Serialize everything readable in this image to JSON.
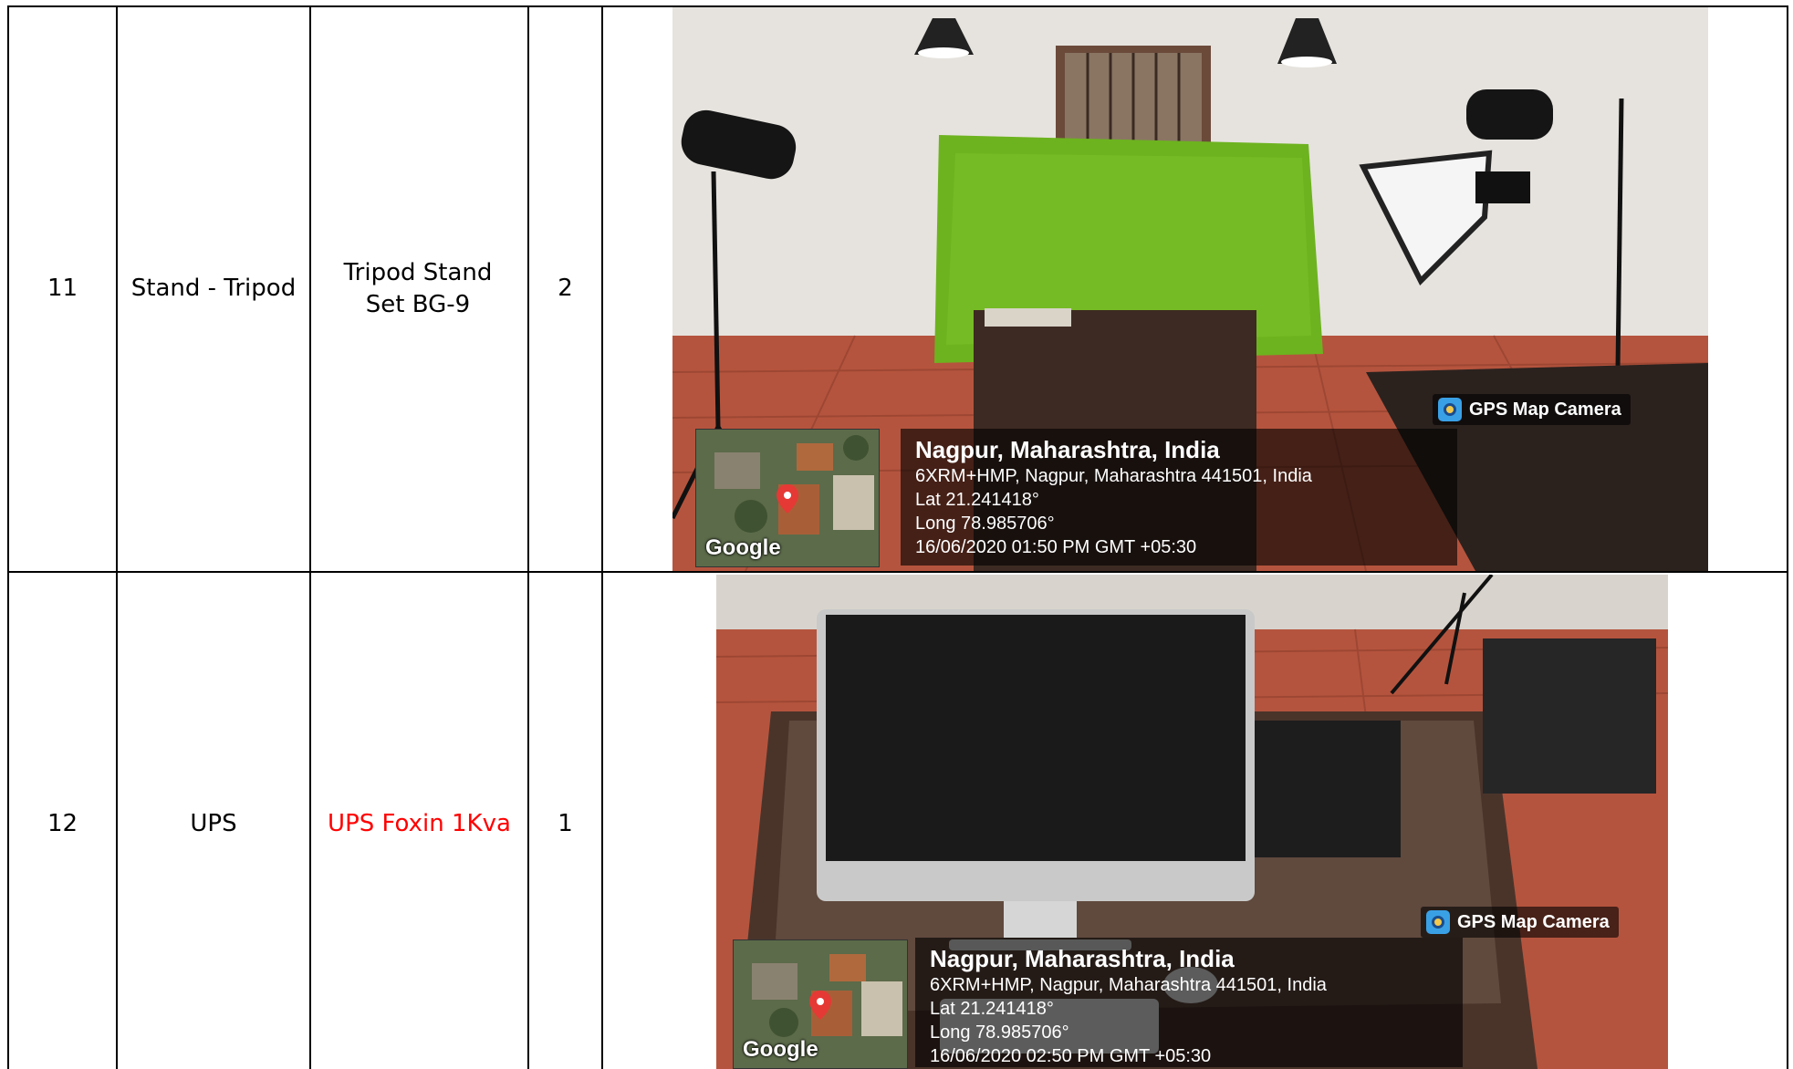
{
  "rows": [
    {
      "sr": "11",
      "item": "Stand - Tripod",
      "model": "Tripod Stand Set BG-9",
      "qty": "2",
      "photo": {
        "location_title": "Nagpur, Maharashtra, India",
        "address": "6XRM+HMP, Nagpur, Maharashtra 441501, India",
        "lat": "Lat 21.241418°",
        "long": "Long 78.985706°",
        "datetime": "16/06/2020 01:50 PM GMT +05:30",
        "badge": "GPS Map Camera",
        "map_brand": "Google"
      }
    },
    {
      "sr": "12",
      "item": "UPS",
      "model": "UPS Foxin 1Kva",
      "model_color": "#ff0000",
      "qty": "1",
      "photo": {
        "location_title": "Nagpur, Maharashtra, India",
        "address": "6XRM+HMP, Nagpur, Maharashtra 441501, India",
        "lat": "Lat 21.241418°",
        "long": "Long 78.985706°",
        "datetime": "16/06/2020 02:50 PM GMT +05:30",
        "badge": "GPS Map Camera",
        "map_brand": "Google"
      }
    }
  ]
}
